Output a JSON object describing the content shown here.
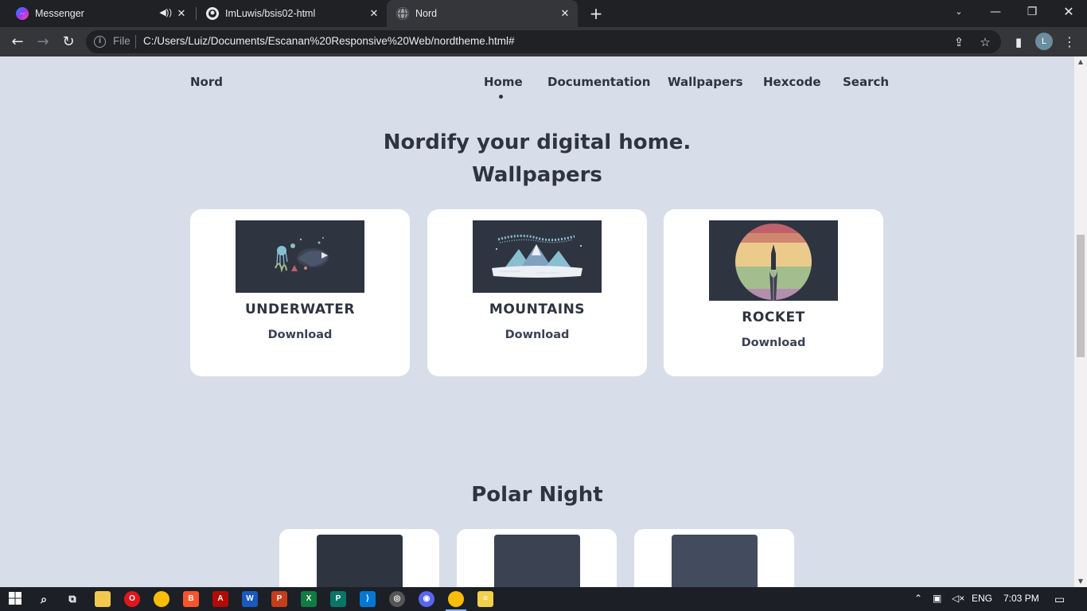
{
  "browser": {
    "tabs": [
      {
        "title": "Messenger",
        "icon": "messenger-icon",
        "audio": true
      },
      {
        "title": "ImLuwis/bsis02-html",
        "icon": "github-icon",
        "audio": false
      },
      {
        "title": "Nord",
        "icon": "globe-icon",
        "active": true
      }
    ],
    "address": {
      "scheme_label": "File",
      "url": "C:/Users/Luiz/Documents/Escanan%20Responsive%20Web/nordtheme.html#"
    },
    "profile_initial": "L"
  },
  "page": {
    "nav": {
      "brand": "Nord",
      "links": [
        "Home",
        "Documentation",
        "Wallpapers",
        "Hexcode",
        "Search"
      ],
      "active_link": "Home"
    },
    "hero": {
      "title": "Nordify your digital home.",
      "subtitle": "Wallpapers"
    },
    "wallpapers": [
      {
        "name": "UNDERWATER",
        "download": "Download",
        "image": "underwater-wallpaper"
      },
      {
        "name": "MOUNTAINS",
        "download": "Download",
        "image": "mountains-wallpaper"
      },
      {
        "name": "ROCKET",
        "download": "Download",
        "image": "rocket-wallpaper"
      }
    ],
    "polar_night": {
      "title": "Polar Night",
      "swatches": [
        "#2e3440",
        "#3b4252",
        "#434c5e"
      ]
    }
  },
  "taskbar": {
    "language": "ENG",
    "time": "7:03 PM"
  },
  "colors": {
    "background": "#d8dee9",
    "text": "#2e3440",
    "card": "#ffffff"
  }
}
